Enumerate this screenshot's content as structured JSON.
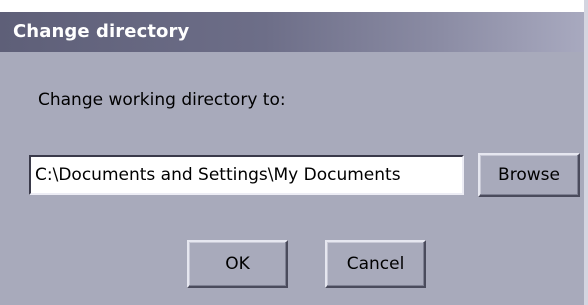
{
  "dialog": {
    "title": "Change directory",
    "prompt": "Change working directory to:",
    "path_value": "C:\\Documents and Settings\\My Documents",
    "browse_label": "Browse",
    "ok_label": "OK",
    "cancel_label": "Cancel"
  },
  "colors": {
    "dialog_background": "#a8aabb",
    "title_bar_start": "#5e5f78",
    "title_bar_end": "#a9aac0",
    "title_text": "#ffffff"
  }
}
